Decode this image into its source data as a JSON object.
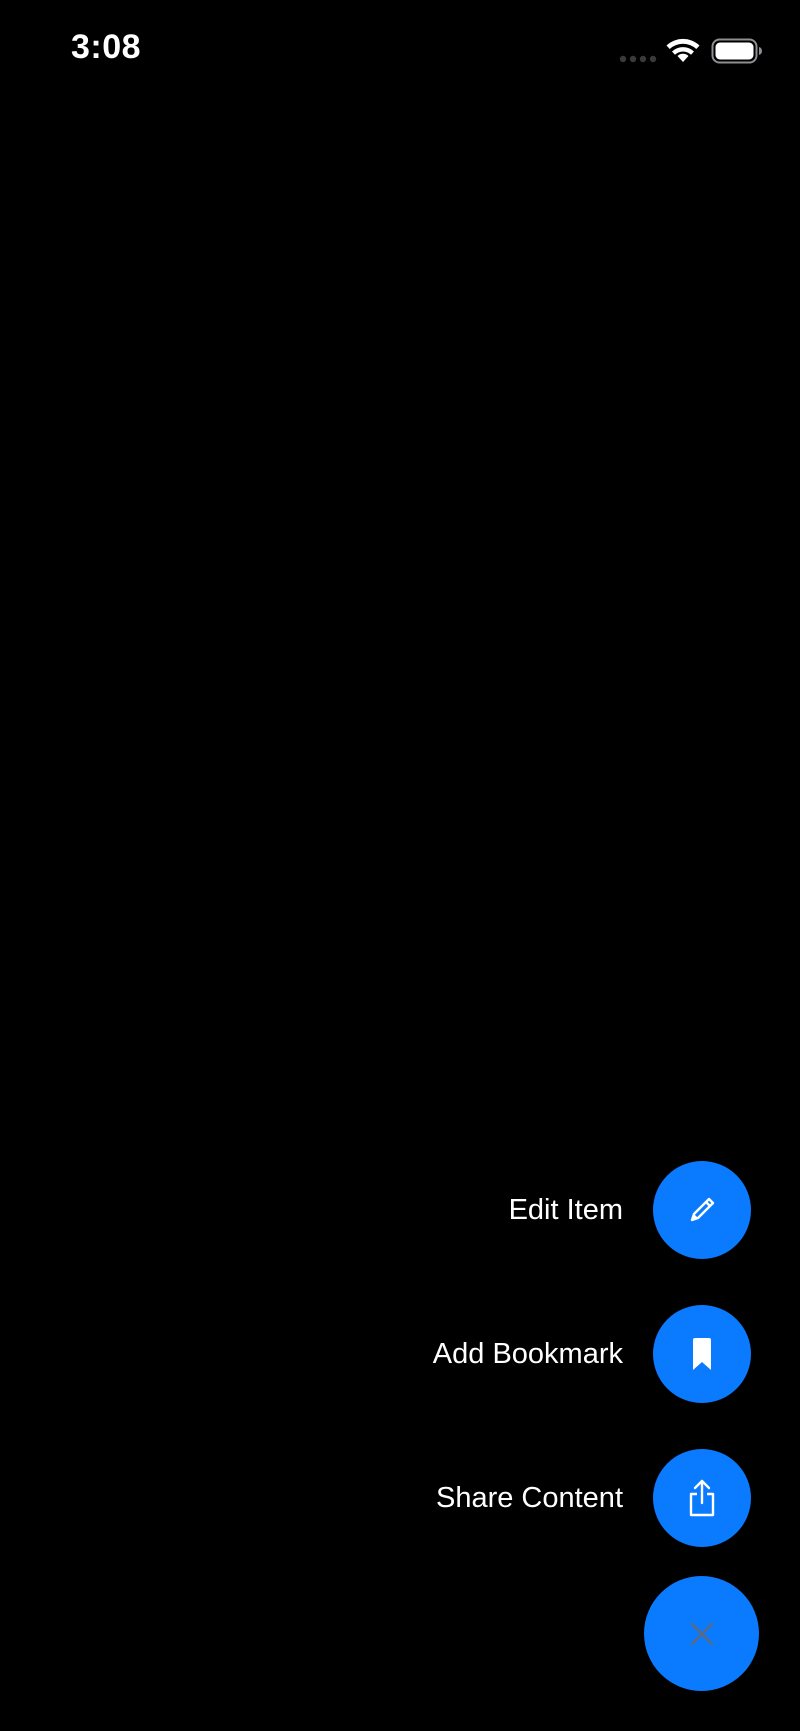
{
  "status_bar": {
    "time": "3:08",
    "signal_icon": "signal-dots-icon",
    "wifi_icon": "wifi-icon",
    "battery_icon": "battery-full-icon"
  },
  "speed_dial": {
    "actions": [
      {
        "label": "Edit Item",
        "icon": "pencil-icon"
      },
      {
        "label": "Add Bookmark",
        "icon": "bookmark-icon"
      },
      {
        "label": "Share Content",
        "icon": "share-icon"
      }
    ],
    "close_icon": "close-icon"
  },
  "colors": {
    "background": "#000000",
    "accent": "#0a7aff",
    "icon": "#ffffff",
    "close_icon": "#5a6b80",
    "text": "#ffffff"
  }
}
